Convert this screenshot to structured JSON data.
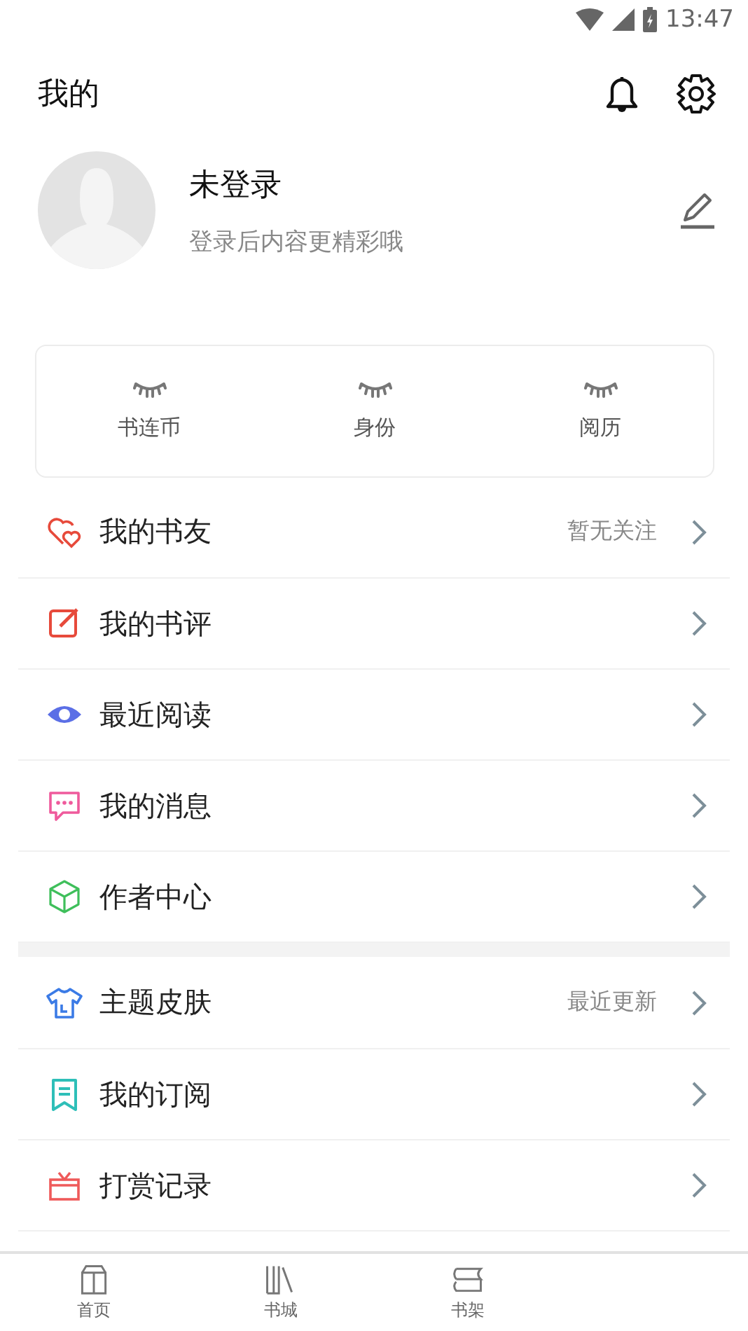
{
  "status_bar": {
    "time": "13:47"
  },
  "header": {
    "title": "我的"
  },
  "profile": {
    "name": "未登录",
    "subtitle": "登录后内容更精彩哦"
  },
  "stats": [
    {
      "label": "书连币"
    },
    {
      "label": "身份"
    },
    {
      "label": "阅历"
    }
  ],
  "menu_sections": [
    {
      "items": [
        {
          "kind": "hearts",
          "label": "我的书友",
          "hint": "暂无关注"
        },
        {
          "kind": "edit",
          "label": "我的书评"
        },
        {
          "kind": "eye",
          "label": "最近阅读"
        },
        {
          "kind": "chat",
          "label": "我的消息"
        },
        {
          "kind": "cube",
          "label": "作者中心"
        }
      ]
    },
    {
      "items": [
        {
          "kind": "shirt",
          "label": "主题皮肤",
          "hint": "最近更新"
        },
        {
          "kind": "bookmark",
          "label": "我的订阅"
        },
        {
          "kind": "gift",
          "label": "打赏记录"
        }
      ]
    }
  ],
  "tab_bar": [
    {
      "kind": "home",
      "label": "首页",
      "selected": false
    },
    {
      "kind": "books",
      "label": "书城",
      "selected": false
    },
    {
      "kind": "shelf",
      "label": "书架",
      "selected": false
    }
  ]
}
